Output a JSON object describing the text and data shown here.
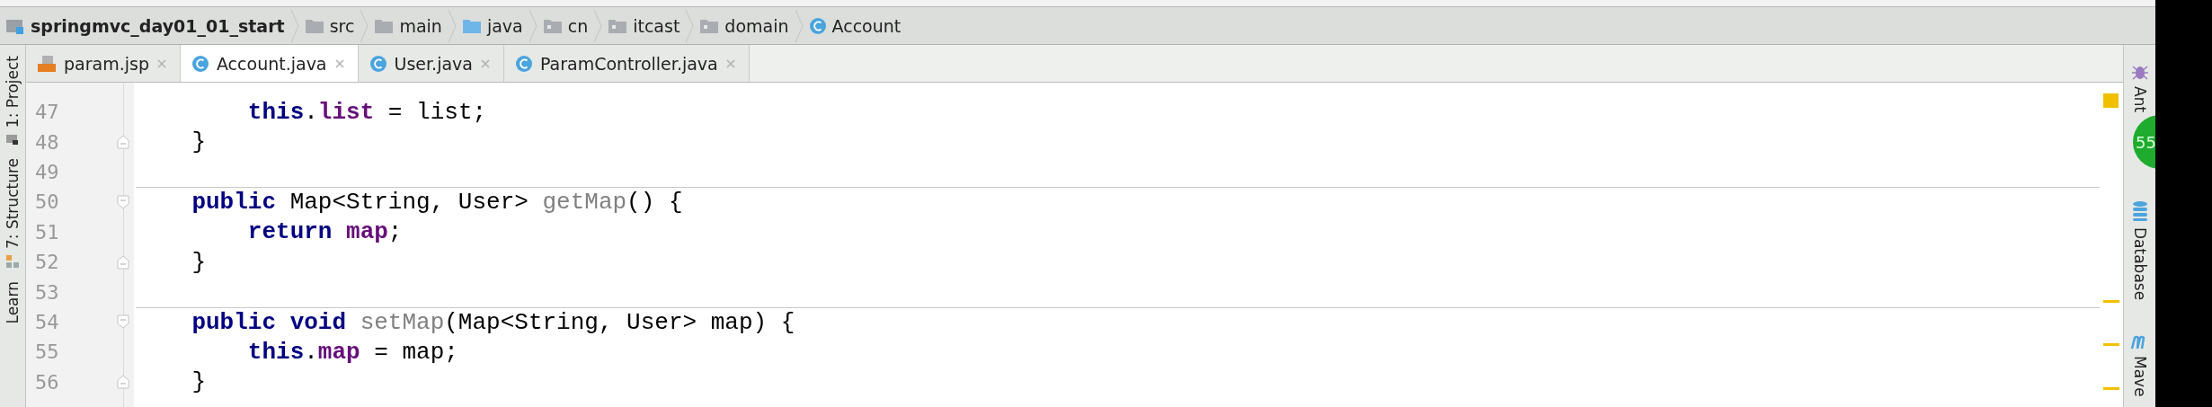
{
  "breadcrumb": [
    {
      "kind": "project",
      "label": "springmvc_day01_01_start"
    },
    {
      "kind": "folder",
      "label": "src"
    },
    {
      "kind": "folder",
      "label": "main"
    },
    {
      "kind": "source-folder",
      "label": "java"
    },
    {
      "kind": "package",
      "label": "cn"
    },
    {
      "kind": "package",
      "label": "itcast"
    },
    {
      "kind": "package",
      "label": "domain"
    },
    {
      "kind": "class",
      "label": "Account"
    }
  ],
  "tabs": [
    {
      "kind": "jsp",
      "label": "param.jsp",
      "selected": false
    },
    {
      "kind": "class",
      "label": "Account.java",
      "selected": true
    },
    {
      "kind": "class",
      "label": "User.java",
      "selected": false
    },
    {
      "kind": "class",
      "label": "ParamController.java",
      "selected": false
    }
  ],
  "left_tools": [
    {
      "kind": "project",
      "label": "1: Project"
    },
    {
      "kind": "structure",
      "label": "7: Structure"
    },
    {
      "kind": "learn",
      "label": "Learn"
    }
  ],
  "right_tools": [
    {
      "kind": "ant",
      "label": "Ant"
    },
    {
      "kind": "database",
      "label": "Database"
    },
    {
      "kind": "maven",
      "label": "Mave"
    }
  ],
  "notification_badge": "55",
  "code": [
    {
      "number": "47",
      "kind": "body",
      "separator_above": false,
      "tokens": [
        {
          "kind": "keyword",
          "text": "        this"
        },
        {
          "kind": "plain",
          "text": "."
        },
        {
          "kind": "field",
          "text": "list"
        },
        {
          "kind": "plain",
          "text": " = list;"
        }
      ]
    },
    {
      "number": "48",
      "kind": "block-end",
      "separator_above": false,
      "tokens": [
        {
          "kind": "plain",
          "text": "    }"
        }
      ]
    },
    {
      "number": "49",
      "kind": "body",
      "separator_above": false
    },
    {
      "number": "50",
      "kind": "block-start",
      "separator_above": true,
      "tokens": [
        {
          "kind": "keyword",
          "text": "    public"
        },
        {
          "kind": "plain",
          "text": " Map<String, User> "
        },
        {
          "kind": "unused",
          "text": "getMap"
        },
        {
          "kind": "plain",
          "text": "() {"
        }
      ]
    },
    {
      "number": "51",
      "kind": "body",
      "separator_above": false,
      "tokens": [
        {
          "kind": "keyword",
          "text": "        return "
        },
        {
          "kind": "field",
          "text": "map"
        },
        {
          "kind": "plain",
          "text": ";"
        }
      ]
    },
    {
      "number": "52",
      "kind": "block-end",
      "separator_above": false,
      "tokens": [
        {
          "kind": "plain",
          "text": "    }"
        }
      ]
    },
    {
      "number": "53",
      "kind": "body",
      "separator_above": false
    },
    {
      "number": "54",
      "kind": "block-start",
      "separator_above": true,
      "tokens": [
        {
          "kind": "keyword",
          "text": "    public void "
        },
        {
          "kind": "unused",
          "text": "setMap"
        },
        {
          "kind": "plain",
          "text": "(Map<String, User> map) {"
        }
      ]
    },
    {
      "number": "55",
      "kind": "body",
      "separator_above": false,
      "tokens": [
        {
          "kind": "keyword",
          "text": "        this"
        },
        {
          "kind": "plain",
          "text": "."
        },
        {
          "kind": "field",
          "text": "map"
        },
        {
          "kind": "plain",
          "text": " = map;"
        }
      ]
    },
    {
      "number": "56",
      "kind": "block-end",
      "separator_above": false,
      "tokens": [
        {
          "kind": "plain",
          "text": "    }"
        }
      ]
    }
  ]
}
